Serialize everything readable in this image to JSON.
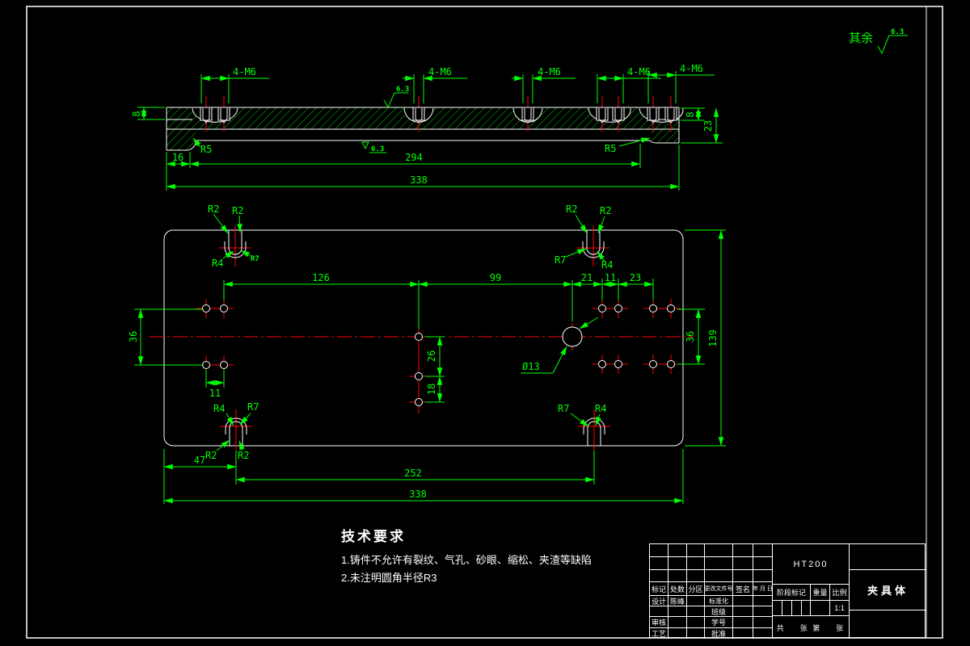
{
  "general_note": {
    "prefix": "其余",
    "roughness": "6.3"
  },
  "section_view": {
    "thread_labels": [
      "4-M6",
      "4-M6",
      "4-M6",
      "4-M6",
      "4-M6"
    ],
    "dim_height_left": "8",
    "dim_height_right": "8",
    "dim_total_height": "23",
    "dim_step": "16",
    "dim_inner_width": "294",
    "dim_total_width": "338",
    "fillet_left": "R5",
    "fillet_right": "R5",
    "rough_top": "6.3",
    "rough_bottom": "6.3"
  },
  "plan_view": {
    "dim_top": [
      "126",
      "99",
      "21",
      "11",
      "23"
    ],
    "dim_row_gap_left": "36",
    "dim_pair_left": "11",
    "dim_center": [
      "26",
      "18"
    ],
    "hole_dia": "Ø13",
    "dim_row_gap_right": "36",
    "dim_height": "139",
    "dim_bottom": [
      "47",
      "252",
      "338"
    ],
    "slot_top_left": [
      "R2",
      "R2",
      "R4",
      "R7"
    ],
    "slot_top_right": [
      "R2",
      "R2",
      "R7",
      "R4"
    ],
    "slot_bottom_left": [
      "R4",
      "R7",
      "R2",
      "R2"
    ],
    "slot_bottom_right": [
      "R7",
      "R4"
    ]
  },
  "tech_requirements": {
    "title": "技术要求",
    "items": [
      "1.铸件不允许有裂纹、气孔、砂眼、缩松、夹渣等缺陷",
      "2.未注明圆角半径R3"
    ]
  },
  "title_block": {
    "headers": {
      "mark": "标记",
      "count": "处数",
      "zone": "分区",
      "doc_no": "更改文件号",
      "sign": "签名",
      "date": "年 月 日"
    },
    "rows": {
      "design": "设计",
      "designer": "陈峰",
      "standardize": "标准化",
      "class_label": "班级",
      "check": "审核",
      "student_no": "学号",
      "process": "工艺",
      "approve": "批准"
    },
    "material": "HT200",
    "stage": "阶段标记",
    "weight": "重量",
    "scale_label": "比例",
    "scale_value": "1:1",
    "sheet": "共    张 第    张",
    "part_name": "夹具体"
  }
}
